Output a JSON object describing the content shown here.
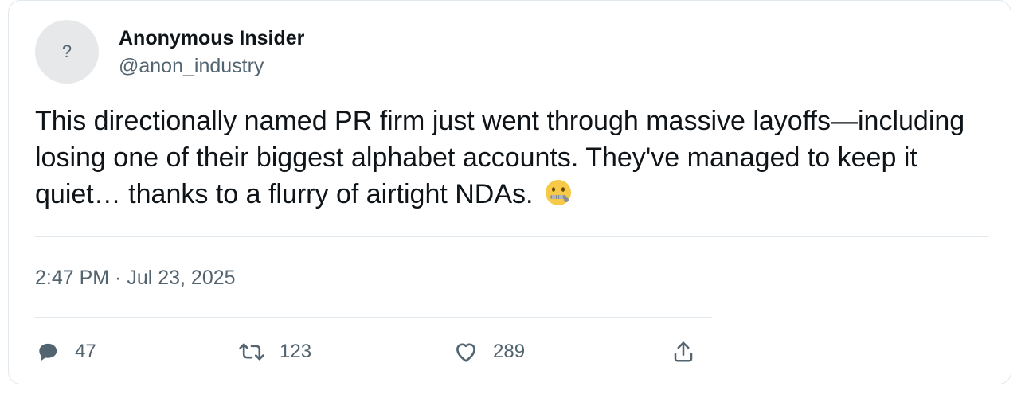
{
  "author": {
    "avatar_glyph": "?",
    "display_name": "Anonymous Insider",
    "handle": "@anon_industry"
  },
  "tweet": {
    "text": "This directionally named PR firm just went through massive layoffs—including losing one of their biggest alphabet accounts. They've managed to keep it quiet… thanks to a flurry of airtight NDAs.",
    "emoji": "zipper-mouth-face",
    "timestamp": "2:47 PM · Jul 23, 2025"
  },
  "actions": {
    "replies": "47",
    "retweets": "123",
    "likes": "289",
    "share_icon": "share-icon"
  },
  "colors": {
    "text": "#0f1419",
    "secondary": "#536471",
    "border": "#e1e8ed",
    "avatar_bg": "#e6e8ea",
    "emoji": "#f7c948"
  }
}
